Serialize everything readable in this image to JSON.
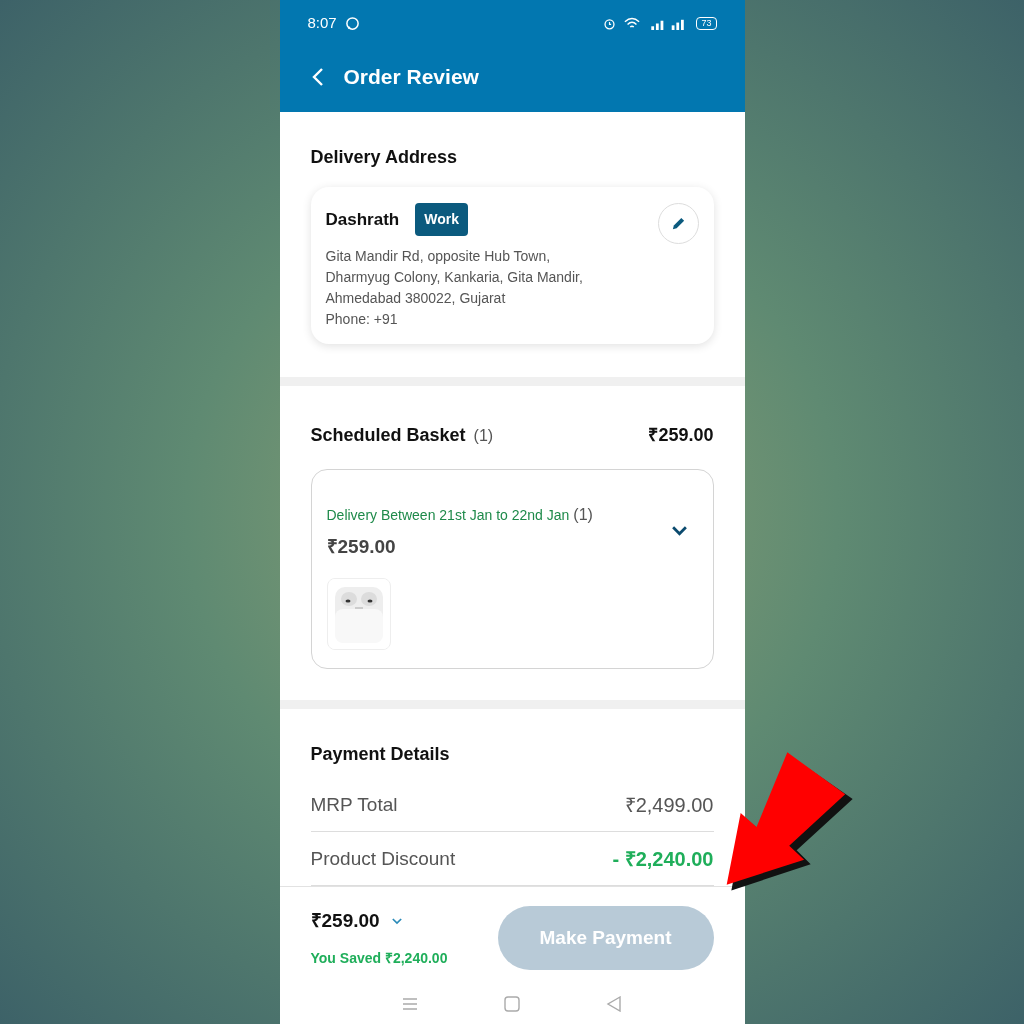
{
  "status_bar": {
    "time": "8:07",
    "battery": "73"
  },
  "header": {
    "title": "Order Review"
  },
  "delivery_address": {
    "title": "Delivery Address",
    "name": "Dashrath",
    "tag": "Work",
    "lines": [
      "Gita Mandir Rd, opposite Hub Town,",
      "Dharmyug Colony, Kankaria, Gita Mandir,",
      "Ahmedabad 380022, Gujarat",
      "Phone: +91"
    ]
  },
  "basket": {
    "title": "Scheduled Basket",
    "count": "(1)",
    "total": "₹259.00",
    "delivery": {
      "label": "Delivery Between 21st Jan to 22nd Jan",
      "count": "(1)",
      "price": "₹259.00"
    }
  },
  "payment": {
    "title": "Payment Details",
    "rows": [
      {
        "label": "MRP Total",
        "value": "₹2,499.00",
        "kind": "plain"
      },
      {
        "label": "Product Discount",
        "value": "- ₹2,240.00",
        "kind": "discount"
      }
    ]
  },
  "footer": {
    "total": "₹259.00",
    "saved": "You Saved ₹2,240.00",
    "button": {
      "label": "Make Payment",
      "disabled": true
    }
  }
}
